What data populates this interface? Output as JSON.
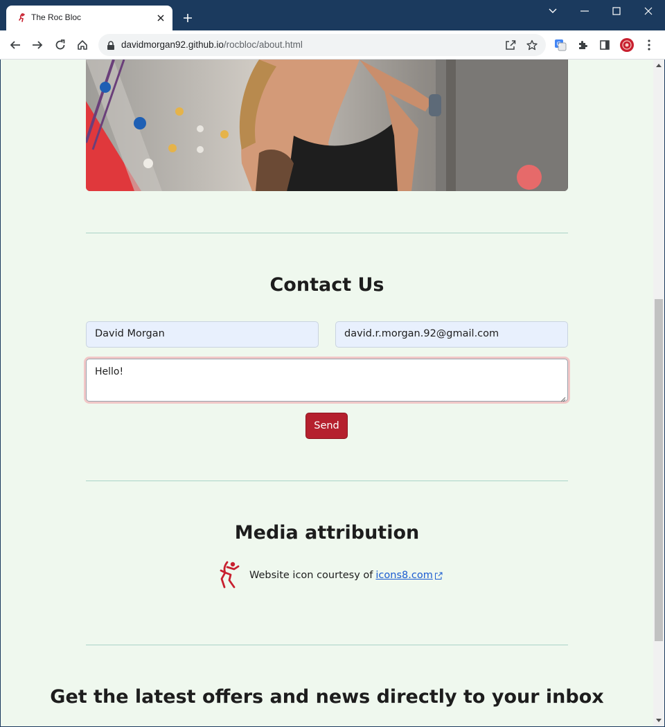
{
  "browser": {
    "tab_title": "The Roc Bloc",
    "url_host": "davidmorgan92.github.io",
    "url_path": "/rocbloc/about.html"
  },
  "contact": {
    "title": "Contact Us",
    "name_value": "David Morgan",
    "email_value": "david.r.morgan.92@gmail.com",
    "message_value": "Hello!",
    "send_label": "Send"
  },
  "media": {
    "title": "Media attribution",
    "text": "Website icon courtesy of",
    "link_label": "icons8.com"
  },
  "newsletter": {
    "title": "Get the latest offers and news directly to your inbox"
  },
  "colors": {
    "page_bg": "#eff8ee",
    "accent": "#b5202e",
    "link": "#1a5bd0",
    "divider": "#a9d3c7",
    "titlebar": "#1b3a5e"
  }
}
